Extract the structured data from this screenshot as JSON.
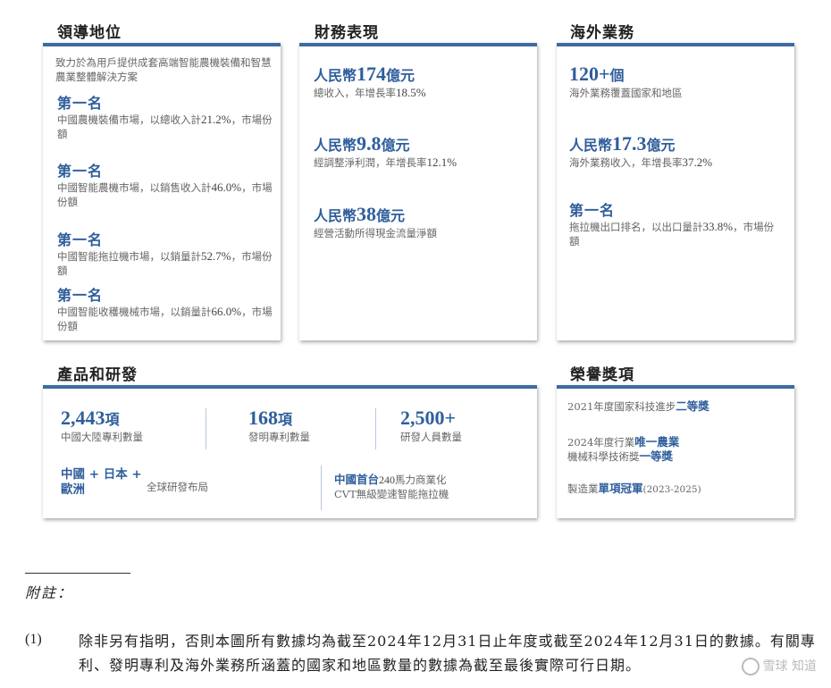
{
  "leadership": {
    "title": "領導地位",
    "intro": "致力於為用戶提供成套高端智能農機裝備和智慧農業整體解決方案",
    "ranks": [
      {
        "rank": "第一名",
        "pre": "中國農機裝備市場，以總收入計",
        "num": "21.2%",
        "post": "，市場份額"
      },
      {
        "rank": "第一名",
        "pre": "中國智能農機市場，以銷售收入計",
        "num": "46.0%",
        "post": "，市場份額"
      },
      {
        "rank": "第一名",
        "pre": "中國智能拖拉機市場，以銷量計",
        "num": "52.7%",
        "post": "，市場份額"
      },
      {
        "rank": "第一名",
        "pre": "中國智能收穫機械市場，以銷量計",
        "num": "66.0%",
        "post": "，市場份額"
      }
    ]
  },
  "finance": {
    "title": "財務表現",
    "items": [
      {
        "prefix": "人民幣",
        "num": "174",
        "suffix": "億元",
        "desc": "總收入，年增長率",
        "desc_num": "18.5%"
      },
      {
        "prefix": "人民幣",
        "num": "9.8",
        "suffix": "億元",
        "desc": "經調整淨利潤，年增長率",
        "desc_num": "12.1%"
      },
      {
        "prefix": "人民幣",
        "num": "38",
        "suffix": "億元",
        "desc": "經營活動所得現金流量淨額",
        "desc_num": ""
      }
    ]
  },
  "overseas": {
    "title": "海外業務",
    "items": [
      {
        "prefix": "",
        "num": "120+",
        "suffix": "個",
        "desc": "海外業務覆蓋國家和地區",
        "desc_num": ""
      },
      {
        "prefix": "人民幣",
        "num": "17.3",
        "suffix": "億元",
        "desc": "海外業務收入，年增長率",
        "desc_num": "37.2%"
      }
    ],
    "rank": "第一名",
    "rank_pre": "拖拉機出口排名，以出口量計",
    "rank_num": "33.8%",
    "rank_post": "，市場份額"
  },
  "rnd": {
    "title": "產品和研發",
    "stats": [
      {
        "num": "2,443",
        "suffix": "項",
        "desc": "中國大陸專利數量"
      },
      {
        "num": "168",
        "suffix": "項",
        "desc": "發明專利數量"
      },
      {
        "num": "2,500+",
        "suffix": "",
        "desc": "研發人員數量"
      }
    ],
    "layout_line1": "中國 + 日本 +",
    "layout_line2": "歐洲",
    "layout_desc": "全球研發布局",
    "first_hl": "中國首台",
    "first_num": "240",
    "first_rest": "馬力商業化",
    "first_line2": "CVT無級變速智能拖拉機"
  },
  "awards": {
    "title": "榮譽獎項",
    "items": [
      {
        "pre": "2021年度國家科技進步",
        "hl": "二等獎",
        "line2_pre": "",
        "line2_hl": "",
        "post": ""
      },
      {
        "pre": "2024年度行業",
        "hl": "唯一農業",
        "line2_pre": "機械科學技術獎",
        "line2_hl": "一等獎",
        "post": ""
      },
      {
        "pre": "製造業",
        "hl": "單項冠軍",
        "line2_pre": "",
        "line2_hl": "",
        "post": "(2023-2025)"
      }
    ]
  },
  "notes": {
    "title": "附註：",
    "num": "(1)",
    "text": "除非另有指明，否則本圖所有數據均為截至2024年12月31日止年度或截至2024年12月31日的數據。有關專利、發明專利及海外業務所涵蓋的國家和地區數量的數據為截至最後實際可行日期。"
  },
  "watermark": "雪球 知道"
}
